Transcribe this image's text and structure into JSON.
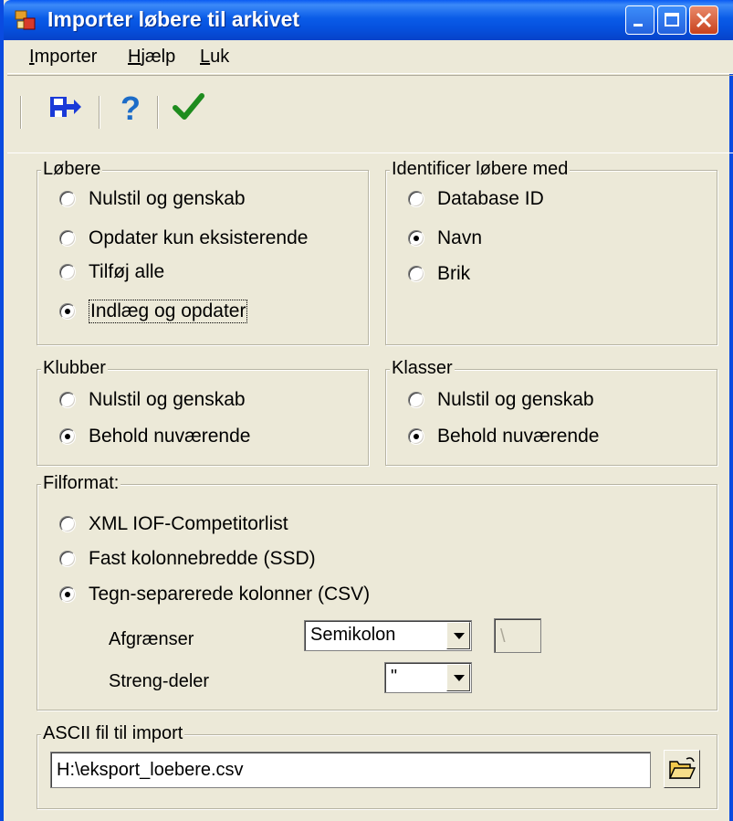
{
  "window": {
    "title": "Importer løbere til arkivet"
  },
  "menu": {
    "items": [
      {
        "underline": "I",
        "rest": "mporter"
      },
      {
        "underline": "H",
        "rest": "jælp"
      },
      {
        "underline": "L",
        "rest": "uk"
      }
    ]
  },
  "toolbar": {
    "buttons": [
      "import-icon",
      "help-icon",
      "checkmark-icon"
    ]
  },
  "groups": {
    "lobere": {
      "legend": "Løbere",
      "options": [
        "Nulstil og genskab",
        "Opdater kun eksisterende",
        "Tilføj alle",
        "Indlæg og opdater"
      ],
      "selected": 3
    },
    "identificer": {
      "legend": "Identificer løbere med",
      "options": [
        "Database ID",
        "Navn",
        "Brik"
      ],
      "selected": 1
    },
    "klubber": {
      "legend": "Klubber",
      "options": [
        "Nulstil og genskab",
        "Behold nuværende"
      ],
      "selected": 1
    },
    "klasser": {
      "legend": "Klasser",
      "options": [
        "Nulstil og genskab",
        "Behold nuværende"
      ],
      "selected": 1
    },
    "filformat": {
      "legend": "Filformat:",
      "options": [
        "XML IOF-Competitorlist",
        "Fast kolonnebredde (SSD)",
        "Tegn-separerede kolonner (CSV)"
      ],
      "selected": 2,
      "afgraenser_label": "Afgrænser",
      "afgraenser_value": "Semikolon",
      "afgraenser_char": "\\",
      "streng_label": "Streng-deler",
      "streng_value": "\""
    },
    "ascii": {
      "legend": "ASCII fil til import",
      "path": "H:\\eksport_loebere.csv"
    }
  },
  "colors": {
    "titlebar": "#0A5CE8",
    "face": "#ECE9D8",
    "check": "#1E8C1E",
    "help": "#1C6CC8"
  }
}
